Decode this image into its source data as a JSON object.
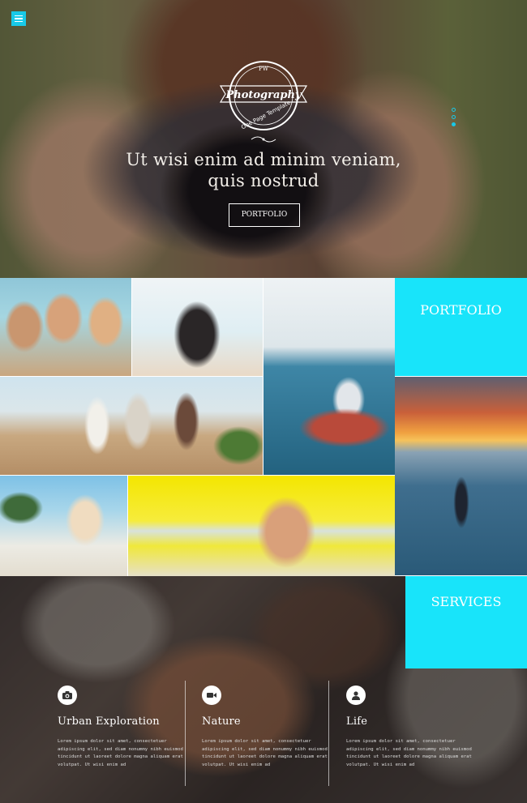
{
  "hero": {
    "logo_top": "PW",
    "logo_title": "Photography",
    "logo_sub": "One Page Template",
    "tagline_line1": "Ut wisi enim ad minim veniam,",
    "tagline_line2": "quis nostrud",
    "button_label": "PORTFOLIO"
  },
  "gallery": {
    "portfolio_label": "PORTFOLIO"
  },
  "services": {
    "label": "SERVICES",
    "items": [
      {
        "icon": "camera-icon",
        "title": "Urban Exploration",
        "text": "Lorem ipsum dolor sit amet, consectetuer adipiscing elit, sed diam nonummy nibh euismod tincidunt ut laoreet dolore magna aliquam erat volutpat. Ut wisi enim ad"
      },
      {
        "icon": "video-camera-icon",
        "title": "Nature",
        "text": "Lorem ipsum dolor sit amet, consectetuer adipiscing elit, sed diam nonummy nibh euismod tincidunt ut laoreet dolore magna aliquam erat volutpat. Ut wisi enim ad"
      },
      {
        "icon": "user-icon",
        "title": "Life",
        "text": "Lorem ipsum dolor sit amet, consectetuer adipiscing elit, sed diam nonummy nibh euismod tincidunt ut laoreet dolore magna aliquam erat volutpat. Ut wisi enim ad"
      }
    ]
  },
  "colors": {
    "accent": "#18e4fa",
    "menu": "#18c9e8"
  }
}
